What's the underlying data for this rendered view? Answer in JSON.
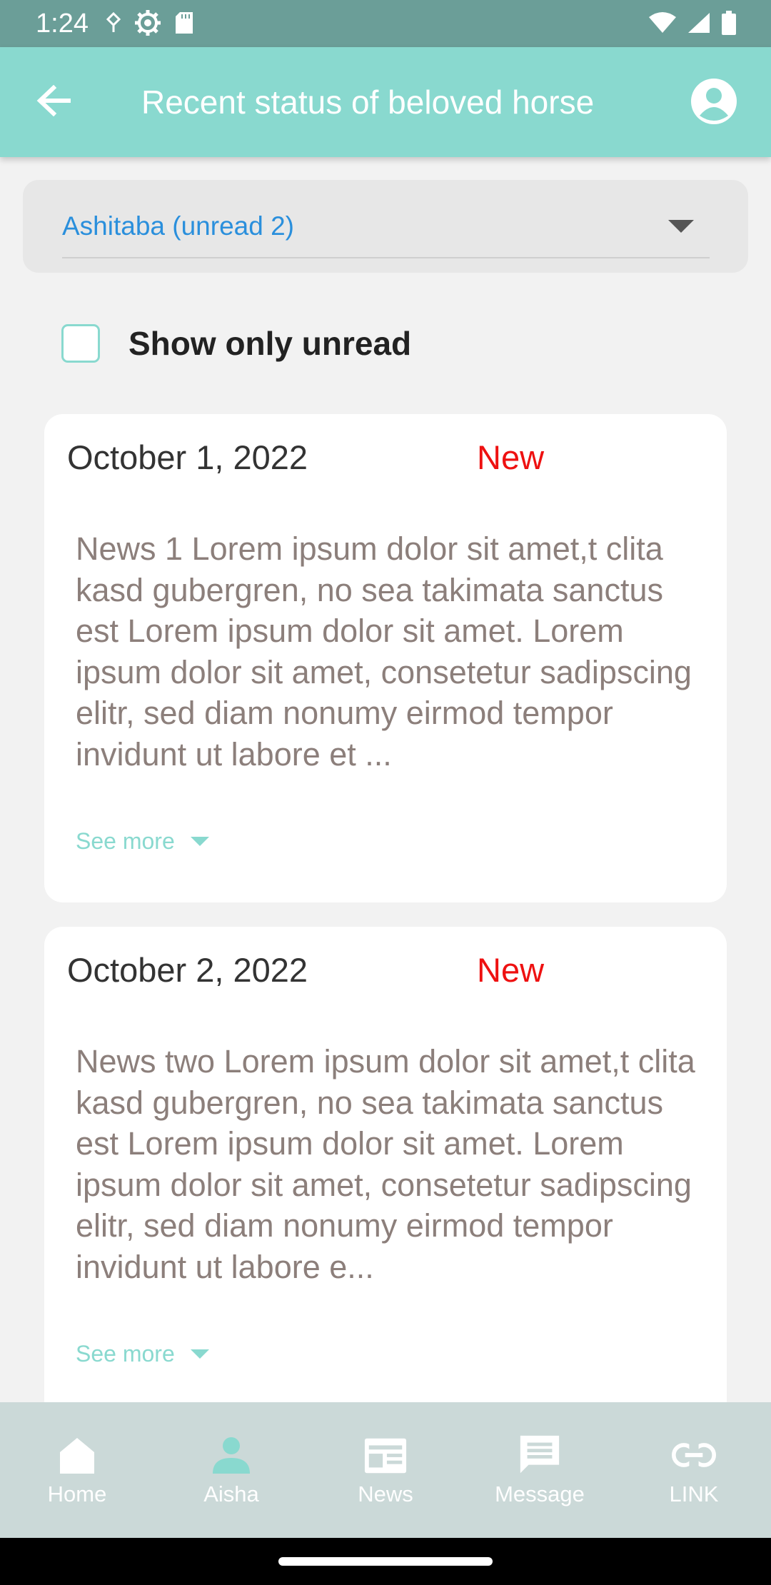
{
  "status_bar": {
    "time": "1:24",
    "left_icons": [
      "location-icon",
      "settings-icon",
      "sd-card-icon"
    ],
    "right_icons": [
      "wifi-icon",
      "signal-icon",
      "battery-icon"
    ]
  },
  "app_bar": {
    "title": "Recent status of beloved horse",
    "back_icon": "arrow-back-icon",
    "account_icon": "account-circle-icon",
    "color": "#89d9cf"
  },
  "horse_select": {
    "value": "Ashitaba (unread 2)",
    "value_color": "#2a8fdc"
  },
  "filter": {
    "label": "Show only unread",
    "checked": false
  },
  "news": [
    {
      "date": "October 1, 2022",
      "badge": "New",
      "body": "News 1 Lorem ipsum dolor sit amet,t clita kasd gubergren, no sea takimata sanctus est Lorem ipsum dolor sit amet. Lorem ipsum dolor sit amet, consetetur sadipscing elitr, sed diam nonumy eirmod tempor invidunt ut labore et ...",
      "see_more": "See more"
    },
    {
      "date": "October 2, 2022",
      "badge": "New",
      "body": "News two Lorem ipsum dolor sit amet,t clita kasd gubergren, no sea takimata sanctus est Lorem ipsum dolor sit amet. Lorem ipsum dolor sit amet, consetetur sadipscing elitr, sed diam nonumy eirmod tempor invidunt ut labore e...",
      "see_more": "See more"
    }
  ],
  "bottom_nav": {
    "items": [
      {
        "label": "Home",
        "icon": "home-icon"
      },
      {
        "label": "Aisha",
        "icon": "person-icon",
        "active": true
      },
      {
        "label": "News",
        "icon": "newspaper-icon"
      },
      {
        "label": "Message",
        "icon": "message-icon"
      },
      {
        "label": "LINK",
        "icon": "link-icon"
      }
    ],
    "active_color": "#89d9cf"
  }
}
